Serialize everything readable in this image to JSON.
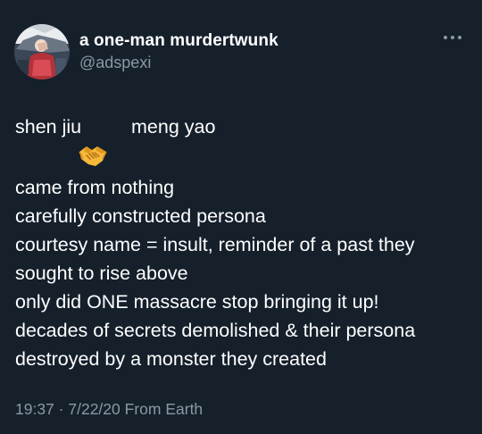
{
  "tweet": {
    "display_name": "a one-man murdertwunk",
    "handle": "@adspexi",
    "more_icon": "more-horizontal-icon",
    "emoji_icon": "handshake-emoji",
    "names": {
      "left": "shen jiu",
      "right": "meng yao"
    },
    "lines": [
      "came from nothing",
      "carefully constructed persona",
      "courtesy name = insult, reminder of a past they",
      "sought to rise above",
      "only did ONE massacre stop bringing it up!",
      "decades of secrets demolished & their persona",
      "destroyed by a monster they created"
    ],
    "time": "19:37",
    "separator": "·",
    "date": "7/22/20",
    "source": "From Earth"
  },
  "colors": {
    "background": "#15202b",
    "text": "#ffffff",
    "muted": "#8b98a5"
  }
}
